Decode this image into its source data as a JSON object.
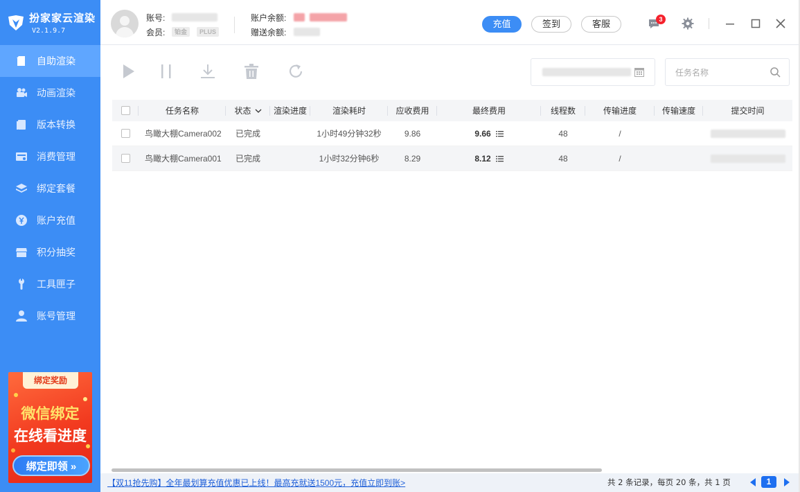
{
  "app": {
    "title": "扮家家云渲染",
    "version": "V2.1.9.7"
  },
  "sidebar": {
    "items": [
      {
        "label": "自助渲染",
        "icon": "render-file-icon",
        "active": true
      },
      {
        "label": "动画渲染",
        "icon": "video-camera-icon",
        "active": false
      },
      {
        "label": "版本转换",
        "icon": "document-icon",
        "active": false
      },
      {
        "label": "消费管理",
        "icon": "billing-icon",
        "active": false
      },
      {
        "label": "绑定套餐",
        "icon": "layers-icon",
        "active": false
      },
      {
        "label": "账户充值",
        "icon": "yen-coin-icon",
        "active": false
      },
      {
        "label": "积分抽奖",
        "icon": "shop-icon",
        "active": false
      },
      {
        "label": "工具匣子",
        "icon": "wrench-icon",
        "active": false
      },
      {
        "label": "账号管理",
        "icon": "user-icon",
        "active": false
      }
    ],
    "promo": {
      "tag": "绑定奖励",
      "line1": "微信绑定",
      "line2": "在线看进度",
      "button": "绑定即领 »"
    }
  },
  "header": {
    "account_label": "账号:",
    "member_label": "会员:",
    "member_badge1": "铂金",
    "member_badge2": "PLUS",
    "balance_label": "账户余额:",
    "gift_label": "赠送余额:",
    "recharge_button": "充值",
    "signin_button": "签到",
    "service_button": "客服",
    "notification_count": "3",
    "colors": {
      "accent": "#3c8df5",
      "notify": "#f5222d"
    }
  },
  "toolbar": {
    "buttons": [
      "play-icon",
      "pause-icon",
      "download-icon",
      "trash-icon",
      "refresh-icon"
    ],
    "search_placeholder": "任务名称"
  },
  "table": {
    "headers": {
      "name": "任务名称",
      "status": "状态",
      "render_progress": "渲染进度",
      "render_time": "渲染耗时",
      "receivable_fee": "应收费用",
      "final_fee": "最终费用",
      "threads": "线程数",
      "transfer_progress": "传输进度",
      "transfer_speed": "传输速度",
      "submit_time": "提交时间"
    },
    "rows": [
      {
        "name": "鸟瞰大棚Camera002",
        "status": "已完成",
        "render_progress": "",
        "render_time": "1小时49分钟32秒",
        "receivable_fee": "9.86",
        "final_fee": "9.66",
        "threads": "48",
        "transfer_progress": "/",
        "transfer_speed": ""
      },
      {
        "name": "鸟瞰大棚Camera001",
        "status": "已完成",
        "render_progress": "",
        "render_time": "1小时32分钟6秒",
        "receivable_fee": "8.29",
        "final_fee": "8.12",
        "threads": "48",
        "transfer_progress": "/",
        "transfer_speed": ""
      }
    ]
  },
  "footer": {
    "announcement": "【双11抢先购】全年最划算充值优惠已上线！最高充就送1500元，充值立即到账>",
    "stats": "共 2 条记录，每页 20 条，共 1 页",
    "current_page": "1"
  }
}
